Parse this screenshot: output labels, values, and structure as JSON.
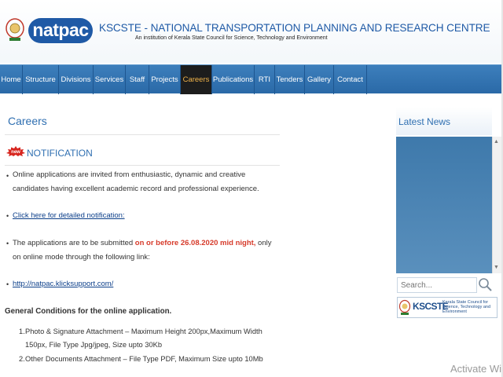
{
  "header": {
    "logo_text": "natpac",
    "org_title": "KSCSTE - NATIONAL TRANSPORTATION PLANNING AND RESEARCH CENTRE",
    "org_subtitle": "An institution of Kerala State Council for Science, Technology and Environment"
  },
  "nav": {
    "items": [
      {
        "label": "Home"
      },
      {
        "label": "Structure"
      },
      {
        "label": "Divisions"
      },
      {
        "label": "Services"
      },
      {
        "label": "Staff"
      },
      {
        "label": "Projects"
      },
      {
        "label": "Careers",
        "active": true
      },
      {
        "label": "Publications"
      },
      {
        "label": "RTI"
      },
      {
        "label": "Tenders"
      },
      {
        "label": "Gallery"
      },
      {
        "label": "Contact"
      }
    ]
  },
  "main": {
    "title": "Careers",
    "new_badge": "new",
    "notification_title": "NOTIFICATION",
    "para1": "Online applications are invited from enthusiastic, dynamic and creative candidates having excellent academic record and professional experience.",
    "link1": "Click here for detailed notification:",
    "para2_a": "The applications are to be submitted ",
    "para2_red": "on or before 26.08.2020 mid night,",
    "para2_b": " only on online mode through the following link:",
    "link2": "http://natpac.klicksupport.com/",
    "general_conditions": "General Conditions for the online application.",
    "conditions": [
      "Photo  & Signature Attachment – Maximum Height 200px,Maximum Width 150px, File Type Jpg/jpeg, Size upto 30Kb",
      "Other Documents Attachment – File Type PDF, Maximum Size upto 10Mb"
    ]
  },
  "sidebar": {
    "latest_news_title": "Latest News",
    "search_placeholder": "Search...",
    "kscste_name": "KSCSTE",
    "kscste_desc": "Kerala State Council for Science, Technology and Environment"
  },
  "overlay": {
    "watermark": "Activate Wi"
  },
  "colors": {
    "brand_blue": "#1f5aa6",
    "nav_blue": "#2f73b4",
    "active_tab_bg": "#1d1d1d",
    "active_tab_text": "#f0b34a",
    "deadline_red": "#d63a2a"
  }
}
